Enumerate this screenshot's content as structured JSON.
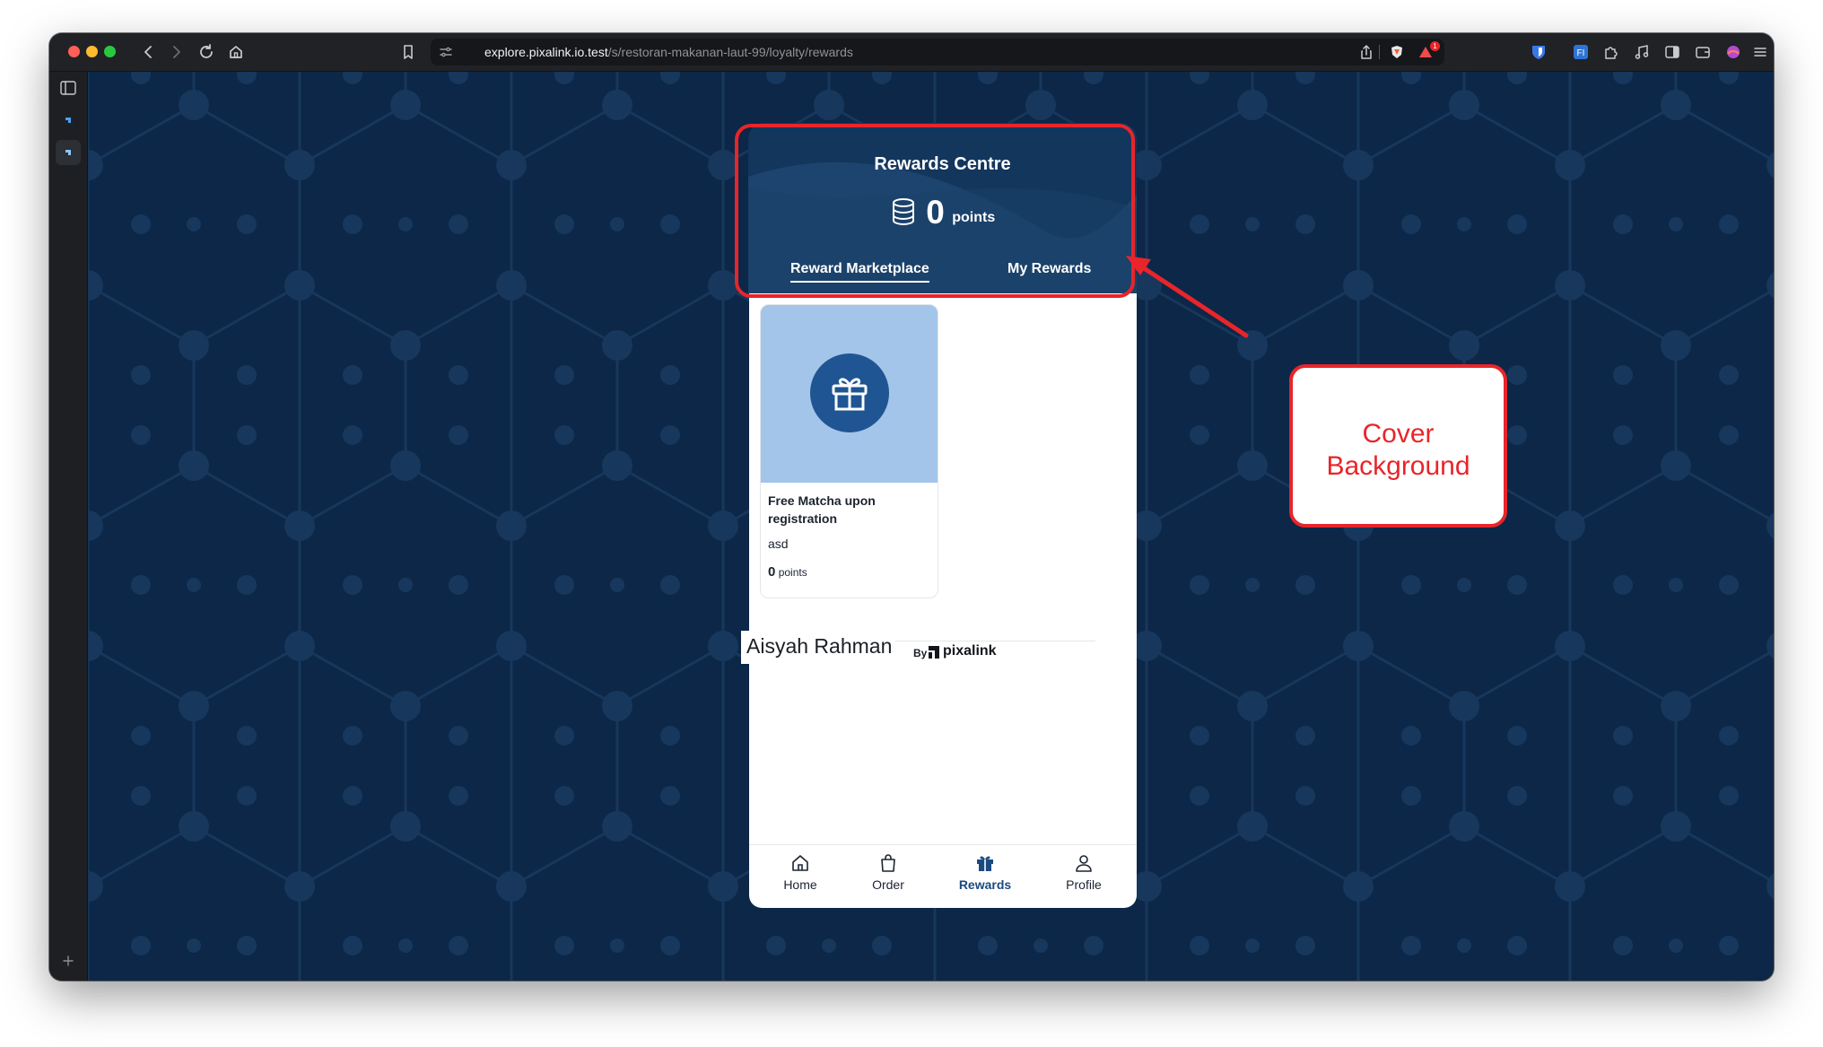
{
  "browser": {
    "url_host": "explore.pixalink.io.test",
    "url_path": "/s/restoran-makanan-laut-99/loyalty/rewards",
    "notification_count": "1"
  },
  "app": {
    "header": {
      "title": "Rewards Centre",
      "points_value": "0",
      "points_unit": "points"
    },
    "tabs": [
      {
        "label": "Reward Marketplace",
        "active": true
      },
      {
        "label": "My Rewards",
        "active": false
      }
    ],
    "rewards": [
      {
        "title": "Free Matcha upon registration",
        "description": "asd",
        "points": "0",
        "points_unit": "points",
        "icon": "gift-icon"
      }
    ],
    "footer": {
      "name": "Aisyah Rahman",
      "by_label": "By",
      "brand": "pixalink"
    },
    "bottom_nav": [
      {
        "label": "Home",
        "icon": "home-icon",
        "active": false
      },
      {
        "label": "Order",
        "icon": "shopping-bag-icon",
        "active": false
      },
      {
        "label": "Rewards",
        "icon": "gift-icon",
        "active": true
      },
      {
        "label": "Profile",
        "icon": "user-icon",
        "active": false
      }
    ]
  },
  "annotation": {
    "label": "Cover Background"
  },
  "colors": {
    "page_background": "#0c2747",
    "cover_background": "#13365d",
    "card_image_background": "#a3c5e9",
    "gift_circle": "#1f5593",
    "annotation_red": "#e8252a",
    "active_nav": "#1a4a7f"
  }
}
